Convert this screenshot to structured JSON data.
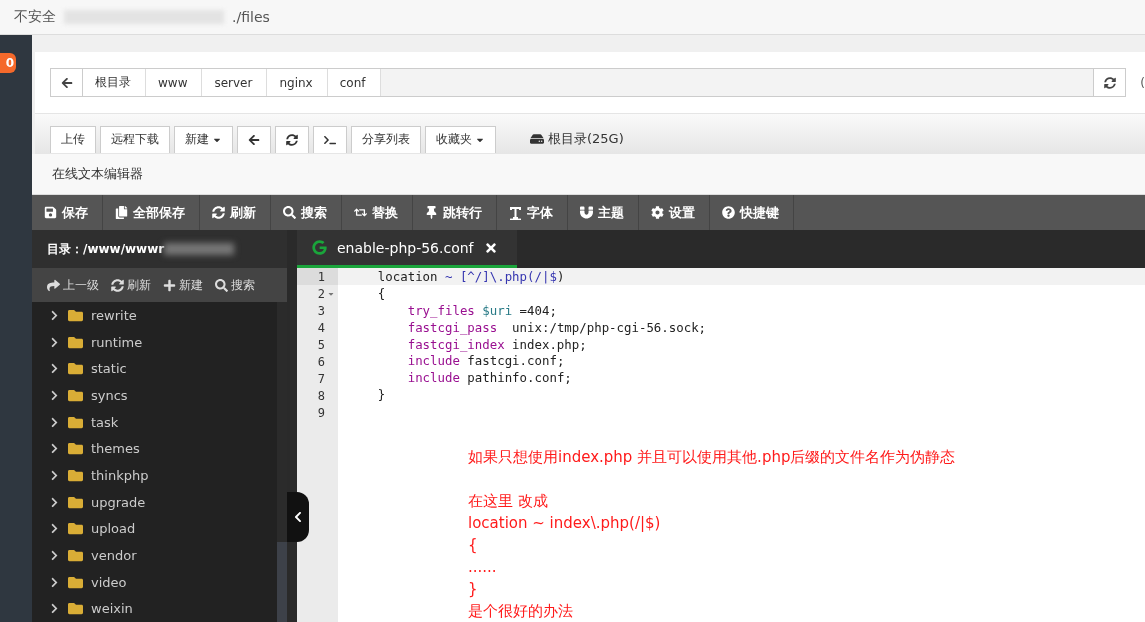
{
  "browser": {
    "security_label": "不安全",
    "url": "./files"
  },
  "nav_badge": "0",
  "breadcrumb": [
    "根目录",
    "www",
    "server",
    "nginx",
    "conf"
  ],
  "side_label": "(",
  "toolbar_buttons": [
    {
      "kind": "text",
      "label": "上传"
    },
    {
      "kind": "text",
      "label": "远程下载"
    },
    {
      "kind": "dropdown",
      "label": "新建"
    },
    {
      "kind": "back"
    },
    {
      "kind": "refresh"
    },
    {
      "kind": "terminal"
    },
    {
      "kind": "text",
      "label": "分享列表"
    },
    {
      "kind": "dropdown",
      "label": "收藏夹"
    }
  ],
  "disk": "根目录(25G)",
  "editor": {
    "title": "在线文本编辑器",
    "actions": [
      {
        "kind": "save",
        "label": "保存"
      },
      {
        "kind": "save-all",
        "label": "全部保存"
      },
      {
        "kind": "refresh",
        "label": "刷新"
      },
      {
        "kind": "search",
        "label": "搜索"
      },
      {
        "kind": "replace",
        "label": "替换"
      },
      {
        "kind": "goto",
        "label": "跳转行"
      },
      {
        "kind": "font",
        "label": "字体"
      },
      {
        "kind": "theme",
        "label": "主题"
      },
      {
        "kind": "settings",
        "label": "设置"
      },
      {
        "kind": "help",
        "label": "快捷键"
      }
    ],
    "directory": "目录：/www/wwwr",
    "tree_tools": [
      {
        "kind": "up",
        "label": "上一级"
      },
      {
        "kind": "refresh",
        "label": "刷新"
      },
      {
        "kind": "new",
        "label": "新建"
      },
      {
        "kind": "search",
        "label": "搜索"
      }
    ],
    "folders": [
      "rewrite",
      "runtime",
      "static",
      "syncs",
      "task",
      "themes",
      "thinkphp",
      "upgrade",
      "upload",
      "vendor",
      "video",
      "weixin"
    ],
    "tab": {
      "name": "enable-php-56.conf",
      "selected": true
    },
    "lines": [
      {
        "number": "1",
        "active": true,
        "foldable": false,
        "tokens": [
          {
            "kind": "plain",
            "text": "    location "
          },
          {
            "kind": "regex",
            "text": "~ [^/]\\.php(/|$"
          },
          {
            "kind": "plain",
            "text": ")"
          }
        ]
      },
      {
        "number": "2",
        "active": false,
        "foldable": true,
        "tokens": [
          {
            "kind": "plain",
            "text": "    {"
          }
        ]
      },
      {
        "number": "3",
        "active": false,
        "foldable": false,
        "tokens": [
          {
            "kind": "keyword",
            "text": "        try_files"
          },
          {
            "kind": "variable",
            "text": " $uri"
          },
          {
            "kind": "plain",
            "text": " =404;"
          }
        ]
      },
      {
        "number": "4",
        "active": false,
        "foldable": false,
        "tokens": [
          {
            "kind": "keyword",
            "text": "        fastcgi_pass"
          },
          {
            "kind": "plain",
            "text": "  unix:/tmp/php-cgi-56.sock;"
          }
        ]
      },
      {
        "number": "5",
        "active": false,
        "foldable": false,
        "tokens": [
          {
            "kind": "keyword",
            "text": "        fastcgi_index"
          },
          {
            "kind": "plain",
            "text": " index.php;"
          }
        ]
      },
      {
        "number": "6",
        "active": false,
        "foldable": false,
        "tokens": [
          {
            "kind": "keyword",
            "text": "        include"
          },
          {
            "kind": "plain",
            "text": " fastcgi.conf;"
          }
        ]
      },
      {
        "number": "7",
        "active": false,
        "foldable": false,
        "tokens": [
          {
            "kind": "keyword",
            "text": "        include"
          },
          {
            "kind": "plain",
            "text": " pathinfo.conf;"
          }
        ]
      },
      {
        "number": "8",
        "active": false,
        "foldable": false,
        "tokens": [
          {
            "kind": "plain",
            "text": "    }"
          }
        ]
      },
      {
        "number": "9",
        "active": false,
        "foldable": false
      }
    ],
    "annotation": [
      [
        "如果只想使用index.php 并且可以使用其他.php后缀的文件名作为伪静态"
      ],
      [
        "在这里 改成",
        "location ~ index\\.php(/|$)",
        "{",
        "......",
        "}",
        "是个很好的办法"
      ]
    ]
  }
}
